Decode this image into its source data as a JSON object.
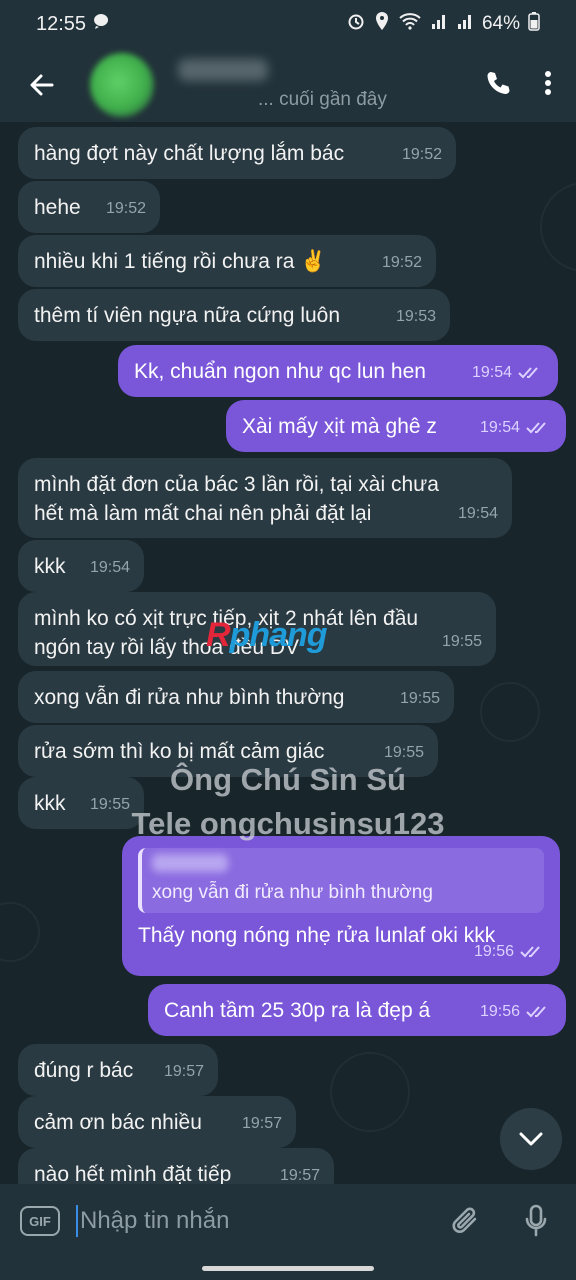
{
  "status_bar": {
    "time": "12:55",
    "battery": "64%"
  },
  "header": {
    "status": "... cuối gần đây"
  },
  "messages": [
    {
      "dir": "in",
      "text": "hàng đợt này chất lượng lắm bác",
      "time": "19:52"
    },
    {
      "dir": "in",
      "text": "hehe",
      "time": "19:52"
    },
    {
      "dir": "in",
      "text": "nhiều khi 1 tiếng rồi chưa ra ✌️",
      "time": "19:52"
    },
    {
      "dir": "in",
      "text": "thêm tí viên ngựa nữa cứng luôn",
      "time": "19:53"
    },
    {
      "dir": "out",
      "text": "Kk, chuẩn ngon như qc lun hen",
      "time": "19:54"
    },
    {
      "dir": "out",
      "text": "Xài mấy xịt mà ghê z",
      "time": "19:54"
    },
    {
      "dir": "in",
      "line1": "mình đặt đơn của bác 3 lần rồi, tại xài chưa",
      "line2": "hết mà làm mất chai nên phải đặt lại",
      "time": "19:54"
    },
    {
      "dir": "in",
      "text": "kkk",
      "time": "19:54"
    },
    {
      "dir": "in",
      "line1": "mình ko có xịt trực tiếp, xịt 2 nhát lên đầu",
      "line2": "ngón tay rồi lấy thoa đều DV",
      "time": "19:55"
    },
    {
      "dir": "in",
      "text": "xong vẫn đi rửa như bình thường",
      "time": "19:55"
    },
    {
      "dir": "in",
      "text": "rửa sớm thì ko bị mất cảm giác",
      "time": "19:55"
    },
    {
      "dir": "in",
      "text": "kkk",
      "time": "19:55"
    },
    {
      "dir": "out",
      "reply_text": "xong vẫn đi rửa như bình thường",
      "text": "Thấy nong nóng nhẹ rửa lunlaf oki kkk",
      "time": "19:56"
    },
    {
      "dir": "out",
      "text": "Canh tầm 25 30p ra là đẹp á",
      "time": "19:56"
    },
    {
      "dir": "in",
      "text": "đúng r bác",
      "time": "19:57"
    },
    {
      "dir": "in",
      "text": "cảm ơn bác nhiều",
      "time": "19:57"
    },
    {
      "dir": "in",
      "text": "nào hết mình đặt tiếp",
      "time": "19:57"
    }
  ],
  "watermark": {
    "logo_r": "R",
    "logo_rest": "phang",
    "line1": "Ông Chú Sìn Sú",
    "line2": "Tele ongchusinsu123"
  },
  "composer": {
    "gif_label": "GIF",
    "placeholder": "Nhập tin nhắn"
  },
  "colors": {
    "outgoing": "#7a56d9",
    "incoming": "#2a3a42",
    "background": "#18262b"
  }
}
